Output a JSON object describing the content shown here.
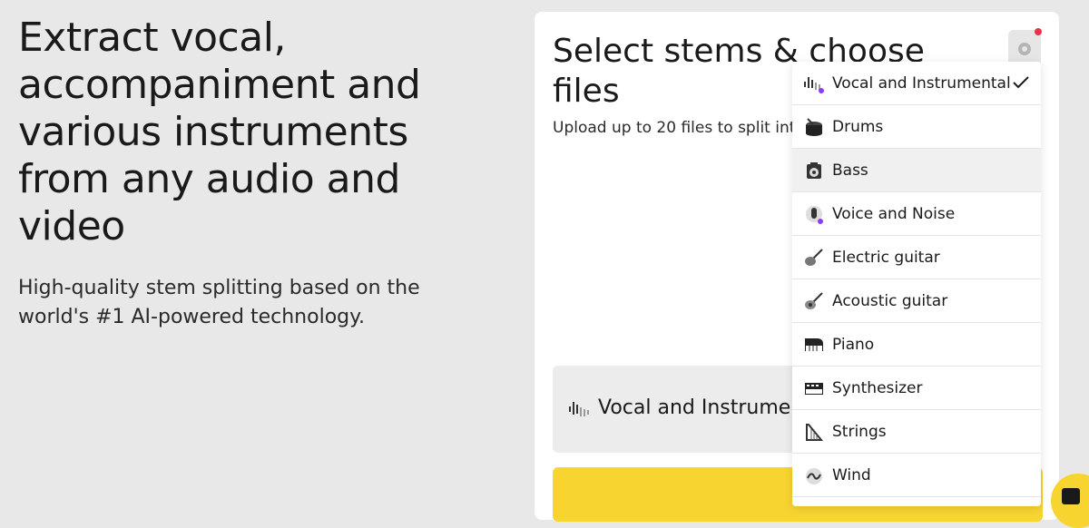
{
  "hero": {
    "title": "Extract vocal, accompaniment and various instruments from any audio and video",
    "subtitle": "High-quality stem splitting based on the world's #1 AI-powered technology."
  },
  "panel": {
    "title": "Select stems & choose files",
    "description": "Upload up to 20 files to split into",
    "selected_stem": "Vocal and Instrumental"
  },
  "dropdown": {
    "items": [
      {
        "label": "Vocal and Instrumental",
        "icon": "waveform-icon",
        "selected": true
      },
      {
        "label": "Drums",
        "icon": "drum-icon"
      },
      {
        "label": "Bass",
        "icon": "bass-amp-icon"
      },
      {
        "label": "Voice and Noise",
        "icon": "microphone-icon"
      },
      {
        "label": "Electric guitar",
        "icon": "electric-guitar-icon"
      },
      {
        "label": "Acoustic guitar",
        "icon": "acoustic-guitar-icon"
      },
      {
        "label": "Piano",
        "icon": "piano-icon"
      },
      {
        "label": "Synthesizer",
        "icon": "synthesizer-icon"
      },
      {
        "label": "Strings",
        "icon": "harp-icon"
      },
      {
        "label": "Wind",
        "icon": "wind-icon"
      }
    ]
  },
  "colors": {
    "accent_yellow": "#f7d430",
    "accent_purple": "#8b3cf7",
    "notification_red": "#e8344a",
    "background": "#e8e8e8"
  }
}
